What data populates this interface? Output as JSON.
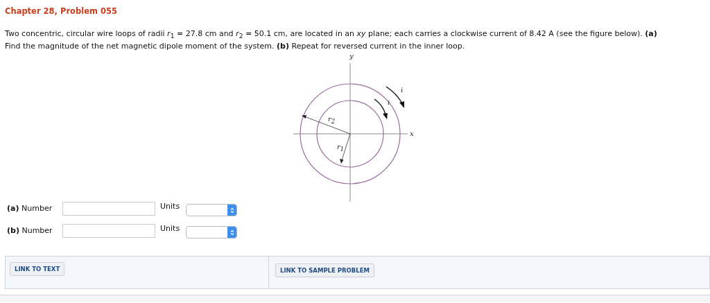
{
  "title": "Chapter 28, Problem 055",
  "problem": "Two concentric, circular wire loops of radii *r*$_{1}$ = 27.8 cm and *r*$_{2}$ = 50.1 cm, are located in an *xy* plane; each carries a clockwise current of 8.42 A (see the figure below). **(a)** Find the magnitude of the net magnetic dipole moment of the system. **(b)** Repeat for reversed current in the inner loop.",
  "figure": {
    "y_label": "y",
    "x_label": "x",
    "outer_current": "i",
    "inner_current": "i",
    "outer_radius": "r$_{2}$",
    "inner_radius": "r$_{1}$"
  },
  "answers": [
    {
      "part": "(a)",
      "label": "Number",
      "units_label": "Units"
    },
    {
      "part": "(b)",
      "label": "Number",
      "units_label": "Units"
    }
  ],
  "links": [
    "LINK TO TEXT",
    "LINK TO SAMPLE PROBLEM"
  ]
}
